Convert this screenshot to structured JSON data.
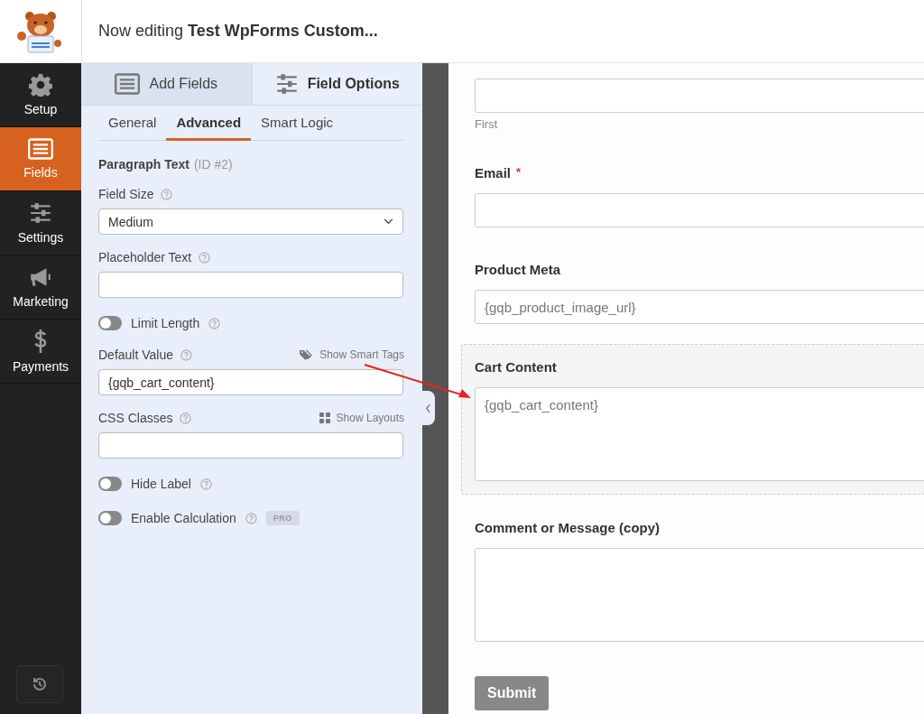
{
  "header": {
    "title": "Now editing **Test WpForms Custom...**"
  },
  "nav": [
    {
      "label": "Setup",
      "selected": false
    },
    {
      "label": "Fields",
      "selected": true
    },
    {
      "label": "Settings",
      "selected": false
    },
    {
      "label": "Marketing",
      "selected": false
    },
    {
      "label": "Payments",
      "selected": false
    }
  ],
  "panel_tabs": [
    {
      "label": "Add Fields",
      "selected": false
    },
    {
      "label": "Field Options",
      "selected": true
    }
  ],
  "subtabs": [
    {
      "label": "General",
      "selected": false
    },
    {
      "label": "Advanced",
      "selected": true
    },
    {
      "label": "Smart Logic",
      "selected": false
    }
  ],
  "field_heading": {
    "name": "Paragraph Text",
    "id": "(ID #2)"
  },
  "options": [
    {
      "kind": "select",
      "label": "Field Size",
      "value": "Medium"
    },
    {
      "kind": "input",
      "label": "Placeholder Text"
    },
    {
      "kind": "toggle",
      "label": "Limit Length",
      "on": false
    },
    {
      "kind": "input",
      "label": "Default Value",
      "value": "{gqb_cart_content}",
      "action": {
        "label": "Show Smart Tags"
      }
    },
    {
      "kind": "input",
      "label": "CSS Classes",
      "action": {
        "label": "Show Layouts"
      }
    },
    {
      "kind": "toggle",
      "label": "Hide Label",
      "on": false
    },
    {
      "kind": "toggle",
      "label": "Enable Calculation",
      "on": false,
      "badge": "PRO"
    }
  ],
  "preview": {
    "fields": [
      {
        "kind": "input",
        "sublabel": "First",
        "highlighted": false
      },
      {
        "kind": "input",
        "label": "Email",
        "required_mark": "*",
        "highlighted": false
      },
      {
        "kind": "input",
        "label": "Product Meta",
        "value": "{gqb_product_image_url}",
        "highlighted": false
      },
      {
        "kind": "textarea",
        "label": "Cart Content",
        "value": "{gqb_cart_content}",
        "highlighted": true
      },
      {
        "kind": "textarea",
        "label": "Comment or Message (copy)",
        "highlighted": false
      }
    ],
    "submit": "Submit"
  }
}
